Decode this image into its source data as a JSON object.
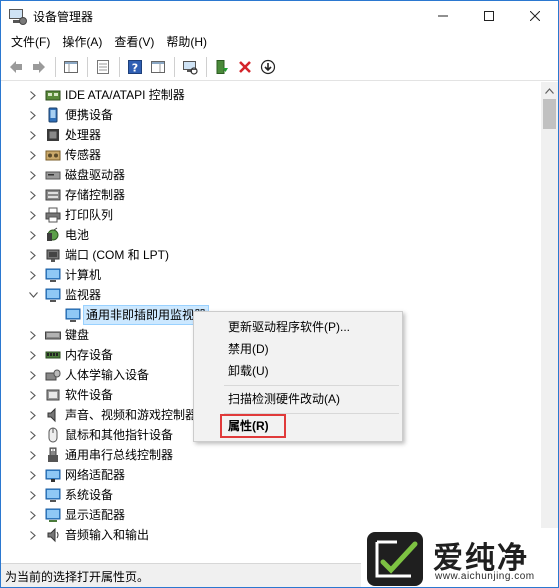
{
  "window": {
    "title": "设备管理器",
    "minimize": "—",
    "maximize": "☐",
    "close": "✕"
  },
  "menubar": {
    "items": [
      "文件(F)",
      "操作(A)",
      "查看(V)",
      "帮助(H)"
    ]
  },
  "toolbar": {
    "buttons": [
      "back-arrow-icon",
      "forward-arrow-icon",
      "properties-panel-icon",
      "show-hide-console-icon",
      "help-icon",
      "action-pane-icon",
      "scan-hardware-icon",
      "enable-device-icon",
      "uninstall-icon",
      "download-driver-icon"
    ]
  },
  "tree": {
    "rows": [
      {
        "label": "IDE ATA/ATAPI 控制器",
        "icon": "ide-controller-icon",
        "expanded": false
      },
      {
        "label": "便携设备",
        "icon": "portable-device-icon",
        "expanded": false
      },
      {
        "label": "处理器",
        "icon": "processor-icon",
        "expanded": false
      },
      {
        "label": "传感器",
        "icon": "sensor-icon",
        "expanded": false
      },
      {
        "label": "磁盘驱动器",
        "icon": "disk-drive-icon",
        "expanded": false
      },
      {
        "label": "存储控制器",
        "icon": "storage-controller-icon",
        "expanded": false
      },
      {
        "label": "打印队列",
        "icon": "printer-icon",
        "expanded": false
      },
      {
        "label": "电池",
        "icon": "battery-icon",
        "expanded": false
      },
      {
        "label": "端口 (COM 和 LPT)",
        "icon": "port-icon",
        "expanded": false
      },
      {
        "label": "计算机",
        "icon": "computer-icon",
        "expanded": false
      },
      {
        "label": "监视器",
        "icon": "monitor-icon",
        "expanded": true
      },
      {
        "label": "通用非即插即用监视器",
        "icon": "monitor-icon",
        "child": true,
        "selected": true
      },
      {
        "label": "键盘",
        "icon": "keyboard-icon",
        "expanded": false
      },
      {
        "label": "内存设备",
        "icon": "memory-icon",
        "expanded": false
      },
      {
        "label": "人体学输入设备",
        "icon": "hid-icon",
        "expanded": false
      },
      {
        "label": "软件设备",
        "icon": "software-device-icon",
        "expanded": false
      },
      {
        "label": "声音、视频和游戏控制器",
        "icon": "audio-icon",
        "expanded": false
      },
      {
        "label": "鼠标和其他指针设备",
        "icon": "mouse-icon",
        "expanded": false
      },
      {
        "label": "通用串行总线控制器",
        "icon": "usb-icon",
        "expanded": false
      },
      {
        "label": "网络适配器",
        "icon": "network-adapter-icon",
        "expanded": false
      },
      {
        "label": "系统设备",
        "icon": "system-device-icon",
        "expanded": false
      },
      {
        "label": "显示适配器",
        "icon": "display-adapter-icon",
        "expanded": false
      },
      {
        "label": "音频输入和输出",
        "icon": "audio-io-icon",
        "expanded": false
      }
    ]
  },
  "context_menu": {
    "items": [
      "更新驱动程序软件(P)...",
      "禁用(D)",
      "卸载(U)",
      "扫描检测硬件改动(A)",
      "属性(R)"
    ],
    "highlight_color": "#e03a3a"
  },
  "statusbar": {
    "text": "为当前的选择打开属性页。"
  },
  "watermark": {
    "title": "爱纯净",
    "url": "www.aichunjing.com"
  },
  "colors": {
    "selection_bg": "#cce8ff",
    "window_border": "#2b78d0"
  }
}
